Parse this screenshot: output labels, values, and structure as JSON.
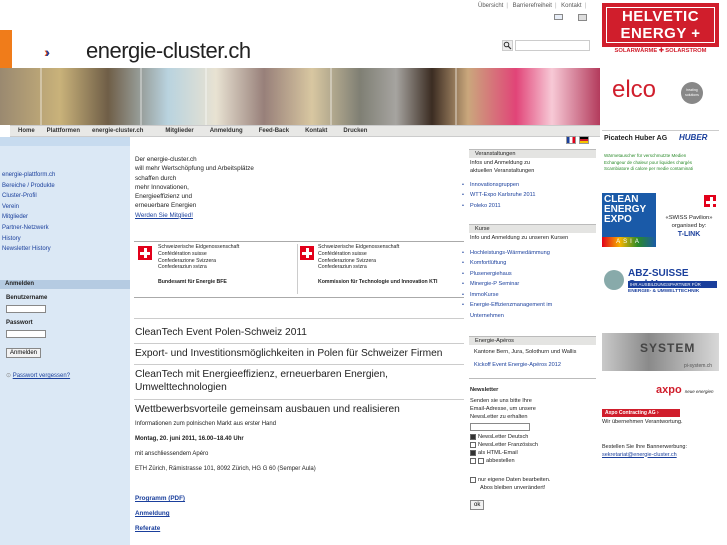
{
  "top_links": [
    "Übersicht",
    "Barrierefreiheit",
    "Kontakt"
  ],
  "site": {
    "logo_arrows": "»»»",
    "logo_text": "energie-cluster.ch"
  },
  "search": {
    "placeholder": ""
  },
  "nav": [
    "Home",
    "Plattformen",
    "energie-cluster.ch",
    "Mitglieder",
    "Anmeldung",
    "Feed-Back",
    "Kontakt",
    "Drucken"
  ],
  "sidebar": {
    "items": [
      "energie-plattform.ch",
      "Bereiche / Produkte",
      "Cluster-Profil",
      "Verein",
      "Mitglieder",
      "Partner-Netzwerk",
      "History",
      "Newsletter History"
    ],
    "login_head": "Anmelden",
    "username_label": "Benutzername",
    "password_label": "Passwort",
    "login_button": "Anmelden",
    "forgot": "Passwort vergessen?"
  },
  "intro": {
    "lines": [
      "Der energie-cluster.ch",
      "will mehr Wertschöpfung und Arbeitsplätze",
      "schaffen durch",
      "mehr Innovationen,",
      "Energieeffizienz und",
      "erneuerbare Energien"
    ],
    "link": "Werden Sie Mitglied!"
  },
  "federal": {
    "left": {
      "lines": [
        "Schweizerische Eidgenossenschaft",
        "Confédération suisse",
        "Confederazione Svizzera",
        "Confederaziun svizra"
      ],
      "office": "Bundesamt für Energie BFE"
    },
    "right": {
      "lines": [
        "Schweizerische Eidgenossenschaft",
        "Confédération suisse",
        "Confederazione Svizzera",
        "Confederaziun svizra"
      ],
      "office": "Kommission für Technologie und Innovation KTI"
    }
  },
  "headlines": [
    "CleanTech Event Polen-Schweiz 2011",
    "Export- und Investitionsmöglichkeiten in Polen für Schweizer Firmen",
    "CleanTech mit Energieeffizienz, erneuerbaren Energien, Umwelttechnologien",
    "Wettbewerbsvorteile gemeinsam ausbauen und realisieren"
  ],
  "event": {
    "info": "Informationen zum polnischen Markt aus erster Hand",
    "date": "Montag, 20. juni 2011, 16.00–18.40 Uhr",
    "apero": "mit anschliessendem Apéro",
    "place": "ETH Zürich, Rämistrasse 101, 8092 Zürich, HG G 60 (Semper Aula)",
    "links": [
      "Programm (PDF)",
      "Anmeldung",
      "Referate"
    ]
  },
  "right": {
    "veranst_head": "Veranstaltungen",
    "veranst_text": [
      "Infos und Anmeldung zu",
      "aktuellen Veranstaltungen"
    ],
    "veranst_items": [
      "Innovationsgruppen",
      "WTT-Expo Karlsruhe 2011",
      "Poleko 2011"
    ],
    "kurse_head": "Kurse",
    "kurse_text": "Info und Anmeldung zu unseren Kursen",
    "kurse_items": [
      "Hochleistungs-Wärmedämmung",
      "Komfortlüftung",
      "Plusenergiehaus",
      "Minergie-P Seminar",
      "ImmoKurse",
      "Energie-Effizienzmanagement im",
      "Unternehmen"
    ],
    "apero_head": "Energie-Apéros",
    "apero_text": "Kantone Bern, Jura, Solothurn und Wallis",
    "apero_link": "Kickoff Event Energie-Apéros 2012",
    "newsletter_head": "Newsletter",
    "newsletter_text": [
      "Senden sie uns bitte Ihre",
      "Email-Adresse, um unsere",
      "NewsLetter zu erhalten"
    ],
    "options": [
      "NewsLetter Deutsch",
      "NewsLetter Französisch",
      "als HTML-Email",
      "abbestellen"
    ],
    "options_checked": [
      true,
      false,
      true,
      false
    ],
    "edit_text": [
      "nur eigene Daten bearbeiten.",
      "Abos bleiben unverändert!"
    ],
    "ok": "ok"
  },
  "ads": {
    "helvetic": [
      "HELVETIC",
      "ENERGY +",
      "SOLARWÄRME ✚ SOLARSTROM"
    ],
    "elco": "elco",
    "elco_badge": "heating solutions",
    "picatech": "Picatech Huber AG",
    "huber": "HUBER",
    "picatech_lines": [
      "Wärmetauscher für verschmutzte Medien",
      "Echangeur de chaleur pour liquides chargés",
      "Scambiatore di calore per medie contaminati"
    ],
    "clean_energy": [
      "CLEAN",
      "ENERGY",
      "EXPO"
    ],
    "asia": "ASIA",
    "swiss_pavilion": [
      "«SWISS Pavilion»",
      "organised by:",
      "T-LINK"
    ],
    "abz": "ABZ-SUISSE GmbH",
    "abz_bar": "IHR AUSBILDUNGSPARTNER FÜR",
    "abz_sub": "ENERGIE- & UMWELTTECHNIK",
    "system": "SYSTEM",
    "system_sub": "pi-system.ch",
    "axpo": "axpo",
    "axpo_tag": "neue energien",
    "axpo_bar": "Axpo Contracting AG ›",
    "axpo_sub": "Wir übernehmen Verantwortung.",
    "order_text": "Bestellen Sie Ihre Bannerwerbung:",
    "order_link": "sekretariat@energie-cluster.ch"
  },
  "colors": {
    "brand_blue": "#1a3f9c",
    "brand_orange": "#f07c1a",
    "swiss_red": "#e2001a",
    "sidebar_bg": "#dbe8f5"
  }
}
